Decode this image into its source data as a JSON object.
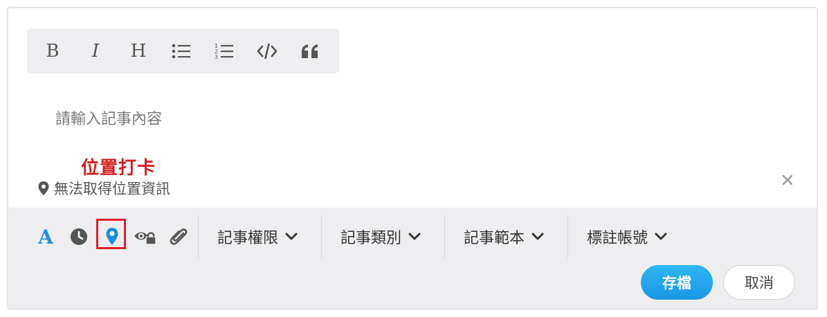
{
  "editor": {
    "placeholder": "請輸入記事內容",
    "format_toolbar": [
      {
        "name": "bold-icon",
        "glyph": "B"
      },
      {
        "name": "italic-icon",
        "glyph": "I"
      },
      {
        "name": "heading-icon",
        "glyph": "H"
      },
      {
        "name": "bullet-list-icon"
      },
      {
        "name": "numbered-list-icon"
      },
      {
        "name": "code-icon"
      },
      {
        "name": "quote-icon"
      }
    ]
  },
  "annotation": {
    "label": "位置打卡",
    "color": "#d42020"
  },
  "location": {
    "text": "無法取得位置資訊",
    "icon": "map-pin-icon"
  },
  "footer": {
    "tools": [
      {
        "name": "font-color-icon",
        "glyph": "A",
        "color": "#1a8fe3"
      },
      {
        "name": "clock-icon",
        "color": "#555555"
      },
      {
        "name": "location-pin-icon",
        "color": "#1a8fe3"
      },
      {
        "name": "eye-lock-icon",
        "color": "#555555"
      },
      {
        "name": "paperclip-icon",
        "color": "#555555"
      }
    ],
    "dropdowns": [
      {
        "label": "記事權限"
      },
      {
        "label": "記事類別"
      },
      {
        "label": "記事範本"
      },
      {
        "label": "標註帳號"
      }
    ],
    "save_label": "存檔",
    "cancel_label": "取消"
  },
  "colors": {
    "accent": "#1a97e5",
    "highlight_border": "#e41d2a",
    "toolbar_bg": "#eeeef1"
  }
}
